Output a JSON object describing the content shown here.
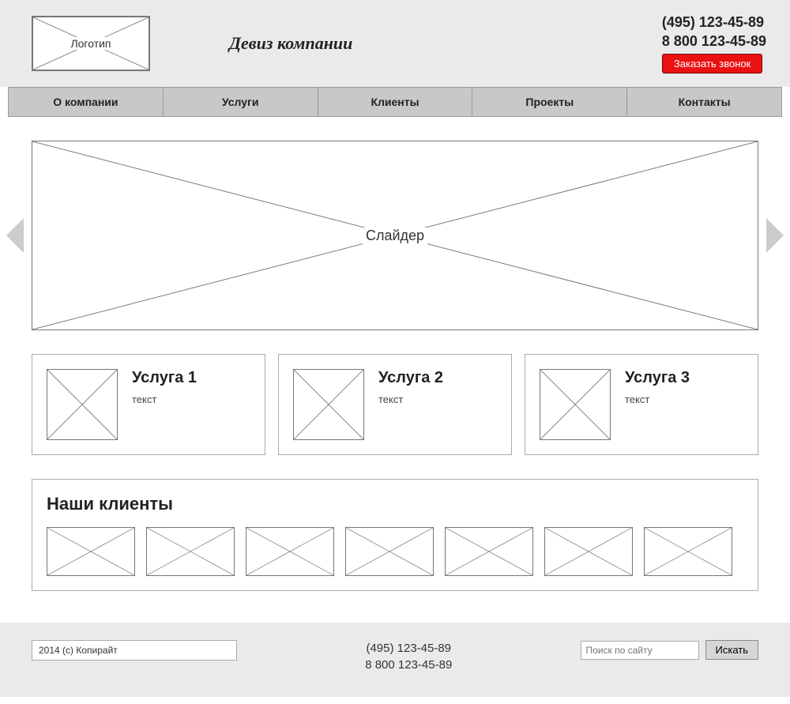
{
  "header": {
    "logo_label": "Логотип",
    "slogan": "Девиз компании",
    "phone1": "(495) 123-45-89",
    "phone2": "8 800 123-45-89",
    "callback_label": "Заказать звонок"
  },
  "nav": {
    "items": [
      "О компании",
      "Услуги",
      "Клиенты",
      "Проекты",
      "Контакты"
    ]
  },
  "slider": {
    "label": "Слайдер"
  },
  "services": [
    {
      "title": "Услуга 1",
      "text": "текст"
    },
    {
      "title": "Услуга 2",
      "text": "текст"
    },
    {
      "title": "Услуга 3",
      "text": "текст"
    }
  ],
  "clients": {
    "heading": "Наши клиенты",
    "count": 7
  },
  "footer": {
    "copyright": "2014 (с) Копирайт",
    "phone1": "(495) 123-45-89",
    "phone2": "8 800 123-45-89",
    "search_placeholder": "Поиск по сайту",
    "search_button": "Искать"
  }
}
